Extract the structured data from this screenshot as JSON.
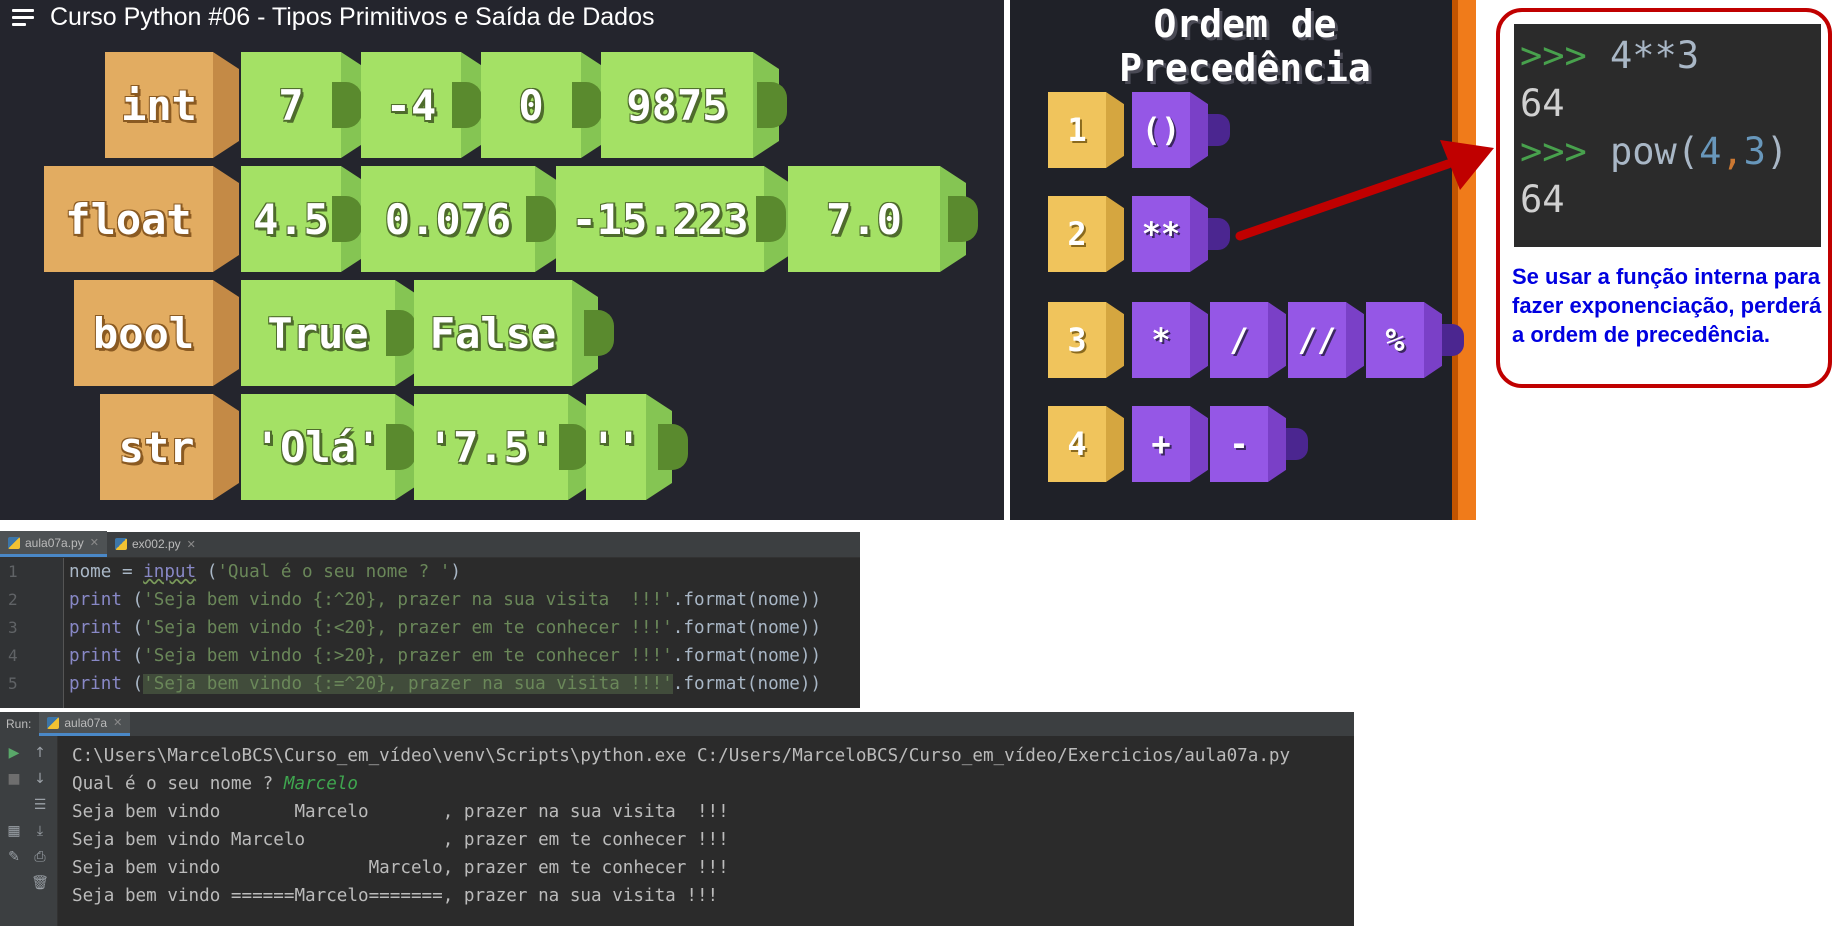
{
  "video": {
    "title": "Curso Python #06 - Tipos Primitivos e Saída de Dados",
    "rows": [
      {
        "type": "int",
        "values": [
          "7",
          "-4",
          "0",
          "9875"
        ]
      },
      {
        "type": "float",
        "values": [
          "4.5",
          "0.076",
          "-15.223",
          "7.0"
        ]
      },
      {
        "type": "bool",
        "values": [
          "True",
          "False"
        ]
      },
      {
        "type": "str",
        "values": [
          "'Olá'",
          "'7.5'",
          "''"
        ]
      }
    ]
  },
  "precedence": {
    "title_line1": "Ordem de",
    "title_line2": "Precedência",
    "levels": [
      {
        "rank": "1",
        "ops": [
          "()"
        ]
      },
      {
        "rank": "2",
        "ops": [
          "**"
        ]
      },
      {
        "rank": "3",
        "ops": [
          "*",
          "/",
          "//",
          "%"
        ]
      },
      {
        "rank": "4",
        "ops": [
          "+",
          "-"
        ]
      }
    ]
  },
  "callout": {
    "repl": {
      "prompt": ">>>",
      "line1_code": "4**3",
      "line1_out": "64",
      "line2_fn": "pow(",
      "line2_a": "4",
      "line2_comma": ",",
      "line2_b": "3",
      "line2_close": ")",
      "line2_out": "64"
    },
    "note": "Se usar a função interna para fazer exponenciação, perderá a ordem de precedência.",
    "colors": {
      "border": "#c00000",
      "note": "#0000e0"
    }
  },
  "editor": {
    "tabs": [
      {
        "label": "aula07a.py",
        "active": true
      },
      {
        "label": "ex002.py",
        "active": false
      }
    ],
    "line_numbers": [
      "1",
      "2",
      "3",
      "4",
      "5"
    ],
    "lines": [
      {
        "pre": "nome = ",
        "fn": "input",
        "open": " (",
        "str": "'Qual é o seu nome ? '",
        "post": ")"
      },
      {
        "fn": "print",
        "open": " (",
        "str": "'Seja bem vindo {:^20}, prazer na sua visita  !!!'",
        "post": ".format(nome))"
      },
      {
        "fn": "print",
        "open": " (",
        "str": "'Seja bem vindo {:<20}, prazer em te conhecer !!!'",
        "post": ".format(nome))"
      },
      {
        "fn": "print",
        "open": " (",
        "str": "'Seja bem vindo {:>20}, prazer em te conhecer !!!'",
        "post": ".format(nome))"
      },
      {
        "fn": "print",
        "open": " (",
        "str": "'Seja bem vindo {:=^20}, prazer na sua visita !!!'",
        "post": ".format(nome))"
      }
    ]
  },
  "run": {
    "label": "Run:",
    "tab": "aula07a",
    "output": [
      "C:\\Users\\MarceloBCS\\Curso_em_vídeo\\venv\\Scripts\\python.exe C:/Users/MarceloBCS/Curso_em_vídeo/Exercicios/aula07a.py",
      "Qual é o seu nome ? ",
      "Seja bem vindo       Marcelo       , prazer na sua visita  !!!",
      "Seja bem vindo Marcelo             , prazer em te conhecer !!!",
      "Seja bem vindo              Marcelo, prazer em te conhecer !!!",
      "Seja bem vindo ======Marcelo=======, prazer na sua visita !!!"
    ],
    "input_value": "Marcelo"
  }
}
